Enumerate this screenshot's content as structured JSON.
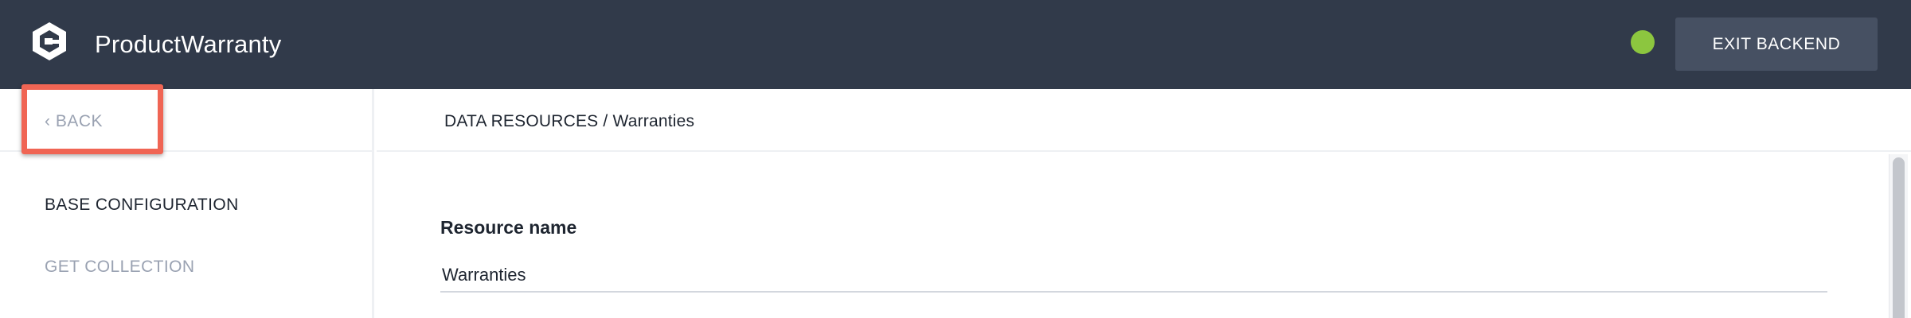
{
  "header": {
    "app_title": "ProductWarranty",
    "logo_icon": "logo-icon",
    "status_color": "#8cc63f",
    "exit_button_label": "EXIT BACKEND"
  },
  "sidebar": {
    "back_label": "‹ BACK",
    "items": [
      {
        "label": "BASE CONFIGURATION",
        "active": true
      },
      {
        "label": "GET COLLECTION",
        "active": false
      }
    ]
  },
  "main": {
    "breadcrumb": "DATA RESOURCES / Warranties",
    "resource_name_label": "Resource name",
    "resource_name_value": "Warranties"
  },
  "colors": {
    "header_bg": "#313a4a",
    "button_bg": "#465062",
    "highlight": "#f06554",
    "muted_text": "#9aa2b2"
  }
}
